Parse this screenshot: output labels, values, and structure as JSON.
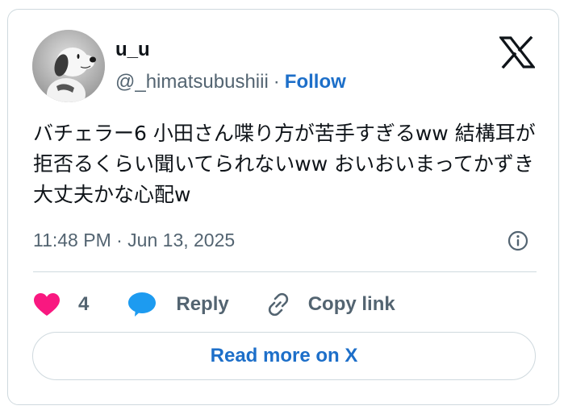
{
  "author": {
    "display_name": "u_u",
    "handle": "@_himatsubushiii",
    "separator": "·",
    "follow_label": "Follow"
  },
  "tweet": {
    "text": "バチェラー6 小田さん喋り方が苦手すぎるww 結構耳が拒否るくらい聞いてられないww おいおいまってかずき大丈夫かな心配w",
    "timestamp": "11:48 PM · Jun 13, 2025"
  },
  "actions": {
    "like_count": "4",
    "reply_label": "Reply",
    "copy_label": "Copy link"
  },
  "read_more_label": "Read more on X",
  "colors": {
    "accent": "#1d6fc9",
    "heart": "#f91880",
    "reply_bubble": "#1d9bf0",
    "muted": "#536471",
    "border": "#cfd9de"
  },
  "icons": {
    "logo": "x-logo-icon",
    "like": "heart-icon",
    "reply": "speech-bubble-icon",
    "copy": "link-icon",
    "info": "info-icon"
  }
}
